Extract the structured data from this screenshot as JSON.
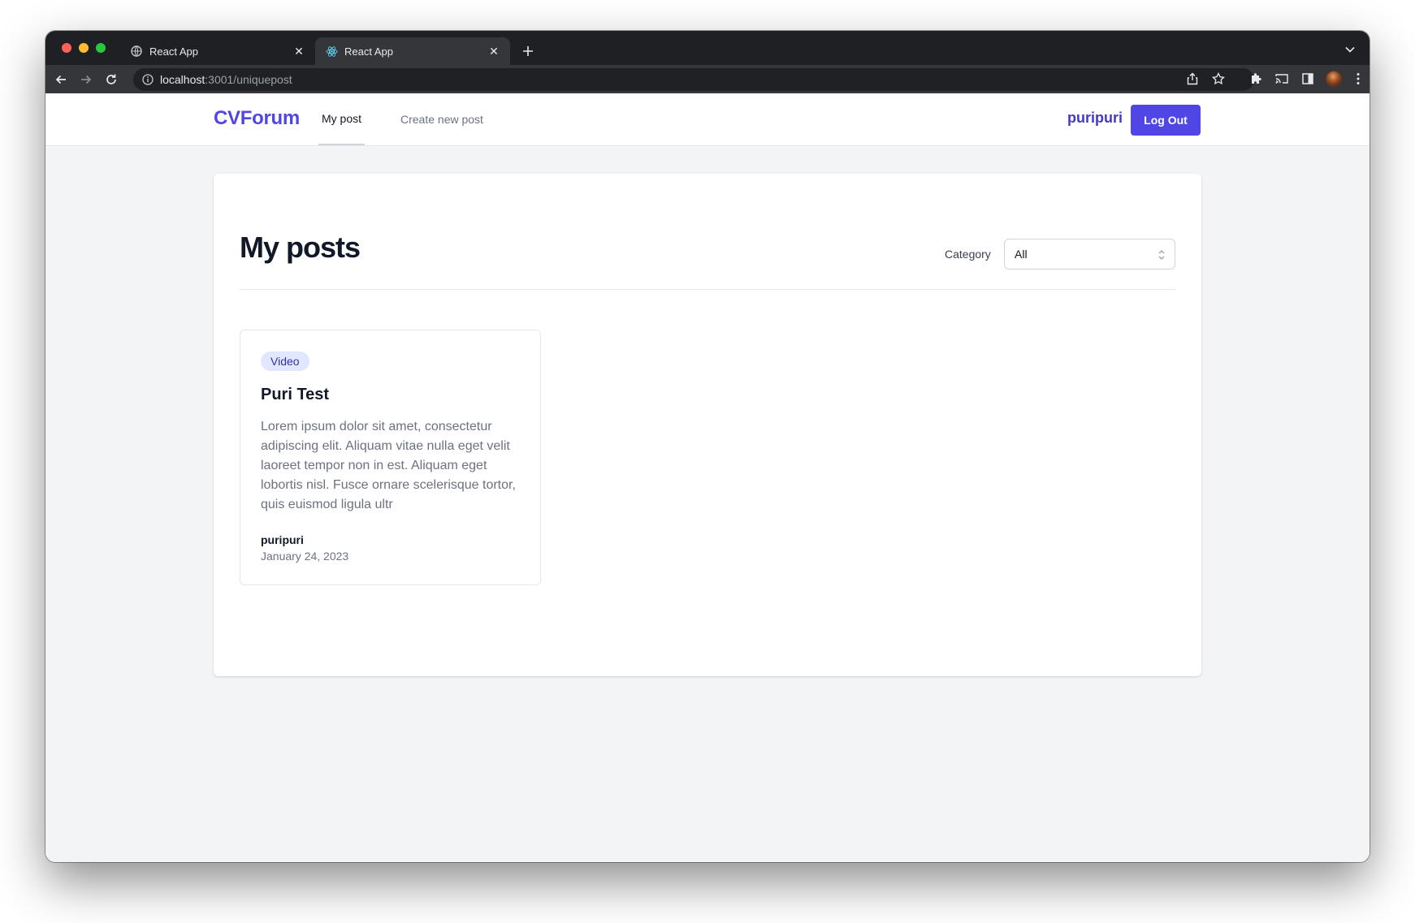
{
  "browser": {
    "tabs": [
      {
        "title": "React App",
        "favicon": "globe-icon",
        "active": false
      },
      {
        "title": "React App",
        "favicon": "react-logo-icon",
        "active": true
      }
    ],
    "url_host": "localhost",
    "url_path": ":3001/uniquepost"
  },
  "navbar": {
    "brand": "CVForum",
    "links": [
      {
        "label": "My post",
        "current": true
      },
      {
        "label": "Create new post",
        "current": false
      }
    ],
    "username": "puripuri",
    "logout_label": "Log Out"
  },
  "page": {
    "title": "My posts",
    "filter_label": "Category",
    "filter_value": "All"
  },
  "posts": [
    {
      "category": "Video",
      "title": "Puri Test",
      "excerpt": "Lorem ipsum dolor sit amet, consectetur adipiscing elit. Aliquam vitae nulla eget velit laoreet tempor non in est. Aliquam eget lobortis nisl. Fusce ornare scelerisque tortor, quis euismod ligula ultr",
      "author": "puripuri",
      "date": "January 24, 2023"
    }
  ],
  "colors": {
    "brand": "#4f46e5",
    "badge_bg": "#e0e7ff",
    "badge_text": "#3730a3",
    "page_bg": "#f3f4f6"
  }
}
